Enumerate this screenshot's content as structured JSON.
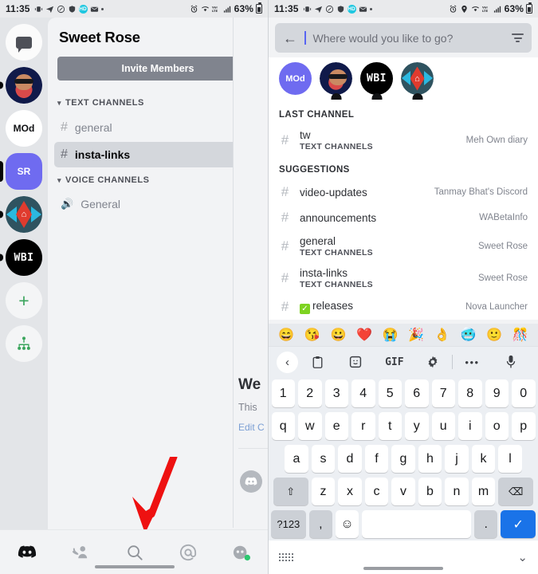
{
  "statusbar": {
    "time": "11:35",
    "battery": "63%",
    "left_icons": [
      "vibrate-icon",
      "telegram-icon",
      "do-not-disturb-icon",
      "adguard-icon",
      "hd-badge-icon",
      "mail-icon",
      "more-dot-icon"
    ],
    "right_icons_left": [
      "alarm-icon"
    ],
    "right_icons": [
      "location-icon",
      "wifi-icon",
      "lte-icon",
      "signal-icon"
    ],
    "hd_badge": "HD"
  },
  "left_screen": {
    "guilds": [
      {
        "name": "direct-messages",
        "label": "",
        "type": "dm"
      },
      {
        "name": "server-avatar-face",
        "label": "",
        "type": "face",
        "has_pill": true
      },
      {
        "name": "server-mod",
        "label": "MOd",
        "type": "text-white"
      },
      {
        "name": "server-sr",
        "label": "SR",
        "type": "text-purple",
        "selected": true
      },
      {
        "name": "server-homescope",
        "label": "",
        "type": "homescope",
        "has_pill": true
      },
      {
        "name": "server-wbi",
        "label": "WBI",
        "type": "text-black",
        "has_pill": true
      },
      {
        "name": "add-server",
        "label": "+",
        "type": "add"
      },
      {
        "name": "explore-servers",
        "label": "",
        "type": "explore"
      }
    ],
    "header": {
      "title": "Sweet Rose",
      "menu_icon": "kebab-menu-icon"
    },
    "invite_button": "Invite Members",
    "categories": [
      {
        "name": "TEXT CHANNELS",
        "add_icon": "plus-icon",
        "channels": [
          {
            "name": "general",
            "type": "text",
            "active": false
          },
          {
            "name": "insta-links",
            "type": "text",
            "active": true
          }
        ]
      },
      {
        "name": "VOICE CHANNELS",
        "add_icon": "plus-icon",
        "channels": [
          {
            "name": "General",
            "type": "voice",
            "active": false
          }
        ]
      }
    ],
    "peek": {
      "welcome": "We",
      "subtitle": "This",
      "edit_link": "Edit C"
    },
    "bottomnav": [
      {
        "name": "discord-home-tab",
        "icon": "discord-logo-icon",
        "active": true
      },
      {
        "name": "friends-tab",
        "icon": "friends-icon",
        "active": false
      },
      {
        "name": "search-tab",
        "icon": "search-icon",
        "active": false
      },
      {
        "name": "mentions-tab",
        "icon": "at-mention-icon",
        "active": false
      },
      {
        "name": "profile-tab",
        "icon": "user-avatar-icon",
        "active": false
      }
    ],
    "annotation": {
      "name": "red-arrow-pointing-to-search",
      "color": "#ee1111"
    }
  },
  "right_screen": {
    "search": {
      "back_icon": "back-arrow-icon",
      "placeholder": "Where would you like to go?",
      "value": "",
      "filter_icon": "filter-icon"
    },
    "avatars": [
      {
        "name": "server-mod",
        "label": "MOd",
        "type": "text-purple"
      },
      {
        "name": "server-avatar-face",
        "label": "",
        "type": "face"
      },
      {
        "name": "server-wbi",
        "label": "WBI",
        "type": "text-black"
      },
      {
        "name": "server-homescope",
        "label": "",
        "type": "homescope"
      }
    ],
    "sections": [
      {
        "title": "LAST CHANNEL",
        "rows": [
          {
            "name": "tw",
            "sub": "TEXT CHANNELS",
            "server": "Meh Own diary",
            "icon": "hash-icon"
          }
        ]
      },
      {
        "title": "SUGGESTIONS",
        "rows": [
          {
            "name": "video-updates",
            "sub": "",
            "server": "Tanmay Bhat's Discord",
            "icon": "hash-icon"
          },
          {
            "name": "announcements",
            "sub": "",
            "server": "WABetaInfo",
            "icon": "hash-icon"
          },
          {
            "name": "general",
            "sub": "TEXT CHANNELS",
            "server": "Sweet Rose",
            "icon": "hash-icon"
          },
          {
            "name": "insta-links",
            "sub": "TEXT CHANNELS",
            "server": "Sweet Rose",
            "icon": "hash-icon"
          },
          {
            "name": "releases",
            "sub": "",
            "server": "Nova Launcher",
            "icon": "hash-icon",
            "prefix_emoji": "white-check-mark"
          }
        ]
      }
    ],
    "keyboard": {
      "emoji_strip": [
        "😄",
        "😘",
        "😀",
        "❤️",
        "😭",
        "🎉",
        "👌",
        "🥶",
        "🙂",
        "🎊"
      ],
      "tools": [
        {
          "name": "keyboard-back-button",
          "glyph": "‹"
        },
        {
          "name": "clipboard-icon",
          "glyph": "📋"
        },
        {
          "name": "sticker-icon",
          "glyph": "🙂"
        },
        {
          "name": "gif-button",
          "glyph": "GIF"
        },
        {
          "name": "settings-gear-icon",
          "glyph": "⚙"
        },
        {
          "name": "more-options-icon",
          "glyph": "•••"
        },
        {
          "name": "microphone-icon",
          "glyph": "🎤"
        }
      ],
      "rows": [
        [
          "1",
          "2",
          "3",
          "4",
          "5",
          "6",
          "7",
          "8",
          "9",
          "0"
        ],
        [
          "q",
          "w",
          "e",
          "r",
          "t",
          "y",
          "u",
          "i",
          "o",
          "p"
        ],
        [
          "a",
          "s",
          "d",
          "f",
          "g",
          "h",
          "j",
          "k",
          "l"
        ]
      ],
      "row4": {
        "shift": "⇧",
        "keys": [
          "z",
          "x",
          "c",
          "v",
          "b",
          "n",
          "m"
        ],
        "backspace": "⌫"
      },
      "row5": {
        "symbols": "?123",
        "comma": ",",
        "emoji": "☺",
        "space": "",
        "period": ".",
        "enter": "✓"
      },
      "bottom": {
        "keyboard_switch_icon": "keyboard-dots-icon",
        "hide_icon": "chevron-down-icon"
      }
    }
  }
}
